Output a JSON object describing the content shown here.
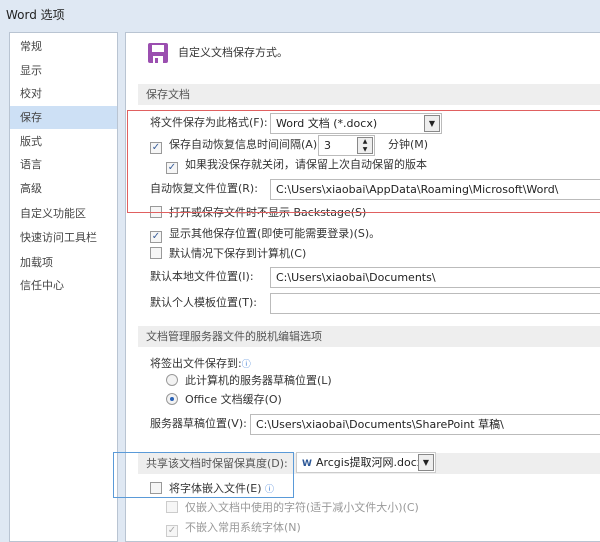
{
  "window_title": "Word 选项",
  "sidebar": {
    "items": [
      {
        "label": "常规"
      },
      {
        "label": "显示"
      },
      {
        "label": "校对"
      },
      {
        "label": "保存",
        "selected": true
      },
      {
        "label": "版式"
      },
      {
        "label": "语言"
      },
      {
        "label": "高级"
      },
      {
        "label": "自定义功能区"
      },
      {
        "label": "快速访问工具栏"
      },
      {
        "label": "加载项"
      },
      {
        "label": "信任中心"
      }
    ]
  },
  "header": {
    "icon": "floppy-disk-icon",
    "text": "自定义文档保存方式。",
    "icon_color": "#9b4fb0"
  },
  "save_section": {
    "title": "保存文档",
    "format_label": "将文件保存为此格式(F):",
    "format_value": "Word 文档 (*.docx)",
    "autorecover_label": "保存自动恢复信息时间间隔(A)",
    "autorecover_checked": true,
    "autorecover_minutes": "3",
    "minutes_label": "分钟(M)",
    "keep_last_label": "如果我没保存就关闭，请保留上次自动保留的版本",
    "keep_last_checked": true,
    "autorecover_location_label": "自动恢复文件位置(R):",
    "autorecover_location_value": "C:\\Users\\xiaobai\\AppData\\Roaming\\Microsoft\\Word\\",
    "no_backstage_label": "打开或保存文件时不显示 Backstage(S)",
    "no_backstage_checked": false,
    "show_other_label": "显示其他保存位置(即使可能需要登录)(S)。",
    "show_other_checked": true,
    "save_to_computer_label": "默认情况下保存到计算机(C)",
    "save_to_computer_checked": false,
    "local_location_label": "默认本地文件位置(I):",
    "local_location_value": "C:\\Users\\xiaobai\\Documents\\",
    "template_location_label": "默认个人模板位置(T):",
    "template_location_value": ""
  },
  "offline_section": {
    "title": "文档管理服务器文件的脱机编辑选项",
    "checkout_label": "将签出文件保存到:",
    "radio_server": "此计算机的服务器草稿位置(L)",
    "radio_office": "Office 文档缓存(O)",
    "selected": "office",
    "server_drafts_label": "服务器草稿位置(V):",
    "server_drafts_value": "C:\\Users\\xiaobai\\Documents\\SharePoint 草稿\\"
  },
  "fidelity_section": {
    "title": "共享该文档时保留保真度(D):",
    "document": "Arcgis提取河网.docx",
    "embed_fonts_label": "将字体嵌入文件(E)",
    "embed_fonts_checked": false,
    "embed_used_label": "仅嵌入文档中使用的字符(适于减小文件大小)(C)",
    "embed_used_checked": false,
    "no_common_label": "不嵌入常用系统字体(N)",
    "no_common_checked": true
  },
  "annotations": {
    "red_box_color": "#e06060",
    "blue_box_color": "#5a9ad8"
  }
}
